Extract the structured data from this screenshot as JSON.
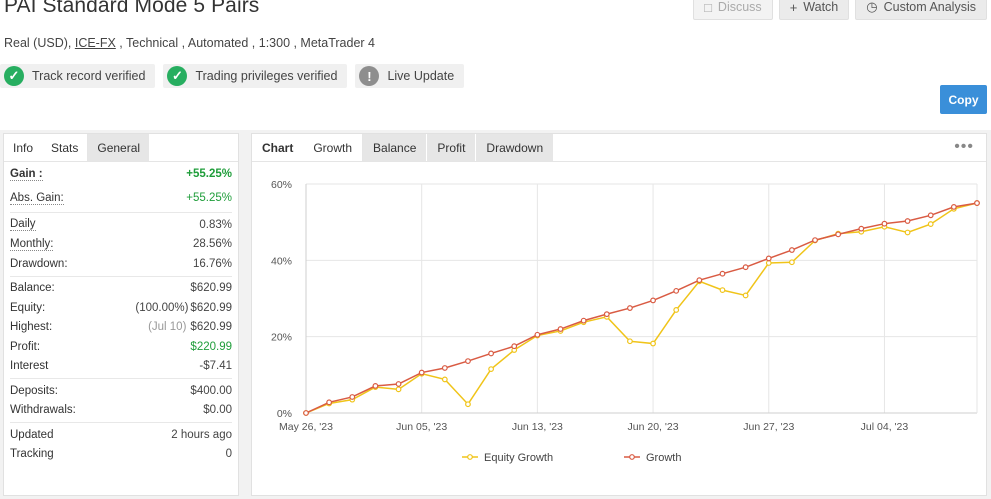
{
  "header": {
    "title": "PAI Standard Mode 5 Pairs",
    "subtitle_pre": "Real (USD), ",
    "broker": "ICE-FX",
    "subtitle_post": " , Technical , Automated , 1:300 , MetaTrader 4"
  },
  "badges": [
    {
      "label": "Track record verified",
      "icon": "check-icon",
      "color": "#27ae60"
    },
    {
      "label": "Trading privileges verified",
      "icon": "check-icon",
      "color": "#27ae60"
    },
    {
      "label": "Live Update",
      "icon": "exclamation-icon",
      "color": "#8e8e8e"
    }
  ],
  "toolbar": {
    "discuss": "Discuss",
    "watch": "Watch",
    "custom_analysis": "Custom Analysis",
    "copy": "Copy"
  },
  "stats_tabs": [
    "Info",
    "Stats",
    "General"
  ],
  "stats": {
    "gain_label": "Gain :",
    "gain": "+55.25%",
    "abs_gain_label": "Abs. Gain:",
    "abs_gain": "+55.25%",
    "daily_label": "Daily",
    "daily": "0.83%",
    "monthly_label": "Monthly:",
    "monthly": "28.56%",
    "drawdown_label": "Drawdown:",
    "drawdown": "16.76%",
    "balance_label": "Balance:",
    "balance": "$620.99",
    "equity_label": "Equity:",
    "equity_pct": "(100.00%)",
    "equity": "$620.99",
    "highest_label": "Highest:",
    "highest_date": "(Jul 10)",
    "highest": "$620.99",
    "profit_label": "Profit:",
    "profit": "$220.99",
    "interest_label": "Interest",
    "interest": "-$7.41",
    "deposits_label": "Deposits:",
    "deposits": "$400.00",
    "withdrawals_label": "Withdrawals:",
    "withdrawals": "$0.00",
    "updated_label": "Updated",
    "updated": "2 hours ago",
    "tracking_label": "Tracking",
    "tracking": "0"
  },
  "chart_tabs": [
    "Chart",
    "Growth",
    "Balance",
    "Profit",
    "Drawdown"
  ],
  "chart_data": {
    "type": "line",
    "x_tick_labels": [
      "May 26, '23",
      "Jun 05, '23",
      "Jun 13, '23",
      "Jun 20, '23",
      "Jun 27, '23",
      "Jul 04, '23"
    ],
    "x_tick_index": [
      0,
      5,
      10,
      15,
      20,
      25
    ],
    "y_tick_labels": [
      "0%",
      "20%",
      "40%",
      "60%"
    ],
    "ylim": [
      0,
      60
    ],
    "grid": true,
    "legend_position": "bottom",
    "series": [
      {
        "name": "Equity Growth",
        "color": "#f0c419",
        "values": [
          0,
          2.5,
          3.5,
          6.8,
          6.2,
          10.3,
          8.8,
          2.3,
          11.5,
          16.5,
          20.3,
          21.5,
          23.8,
          25.2,
          18.8,
          18.2,
          27,
          34.5,
          32.2,
          30.8,
          39.3,
          39.5,
          45.2,
          47,
          47.5,
          48.8,
          47.3,
          49.5,
          53.5,
          55
        ]
      },
      {
        "name": "Growth",
        "color": "#d95b43",
        "values": [
          0,
          2.8,
          4.2,
          7.1,
          7.6,
          10.6,
          11.8,
          13.6,
          15.6,
          17.5,
          20.5,
          22,
          24.2,
          25.9,
          27.5,
          29.5,
          32,
          34.8,
          36.5,
          38.2,
          40.5,
          42.7,
          45.3,
          46.8,
          48.3,
          49.6,
          50.3,
          51.8,
          54,
          55
        ]
      }
    ]
  }
}
